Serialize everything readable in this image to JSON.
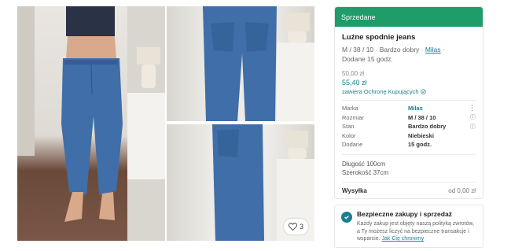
{
  "gallery": {
    "favourites_count": "3"
  },
  "listing": {
    "status_banner": "Sprzedane",
    "title": "Luźne spodnie jeans",
    "subtitle_prefix": "M / 38 / 10 · Bardzo dobry · ",
    "subtitle_brand": "Milas",
    "subtitle_suffix": " ·",
    "added": "Dodane 15 godz.",
    "price_original": "50,00 zł",
    "price_with_protection": "55,40 zł",
    "protection_note": "zawiera Ochronę Kupujących",
    "attributes": [
      {
        "label": "Marka",
        "value": "Milas",
        "link": true,
        "info": ""
      },
      {
        "label": "Rozmiar",
        "value": "M / 38 / 10",
        "link": false,
        "info": "ⓘ"
      },
      {
        "label": "Stan",
        "value": "Bardzo dobry",
        "link": false,
        "info": "ⓘ"
      },
      {
        "label": "Kolor",
        "value": "Niebieski",
        "link": false,
        "info": ""
      },
      {
        "label": "Dodane",
        "value": "15 godz.",
        "link": false,
        "info": ""
      }
    ],
    "description_line1": "Długość 100cm",
    "description_line2": "Szerokość 37cm",
    "shipping_label": "Wysyłka",
    "shipping_value": "od 0,00 zł",
    "more_menu": "⋮"
  },
  "secure": {
    "title": "Bezpieczne zakupy i sprzedaż",
    "body": "Każdy zakup jest objęty naszą polityką zwrotów, a Ty możesz liczyć na bezpieczne transakcje i wsparcie. ",
    "link": "Jak Cię chronimy"
  },
  "colors": {
    "accent": "#1a7f8c",
    "sold_banner": "#1e9c6a",
    "denim": "#3f6ea8"
  }
}
